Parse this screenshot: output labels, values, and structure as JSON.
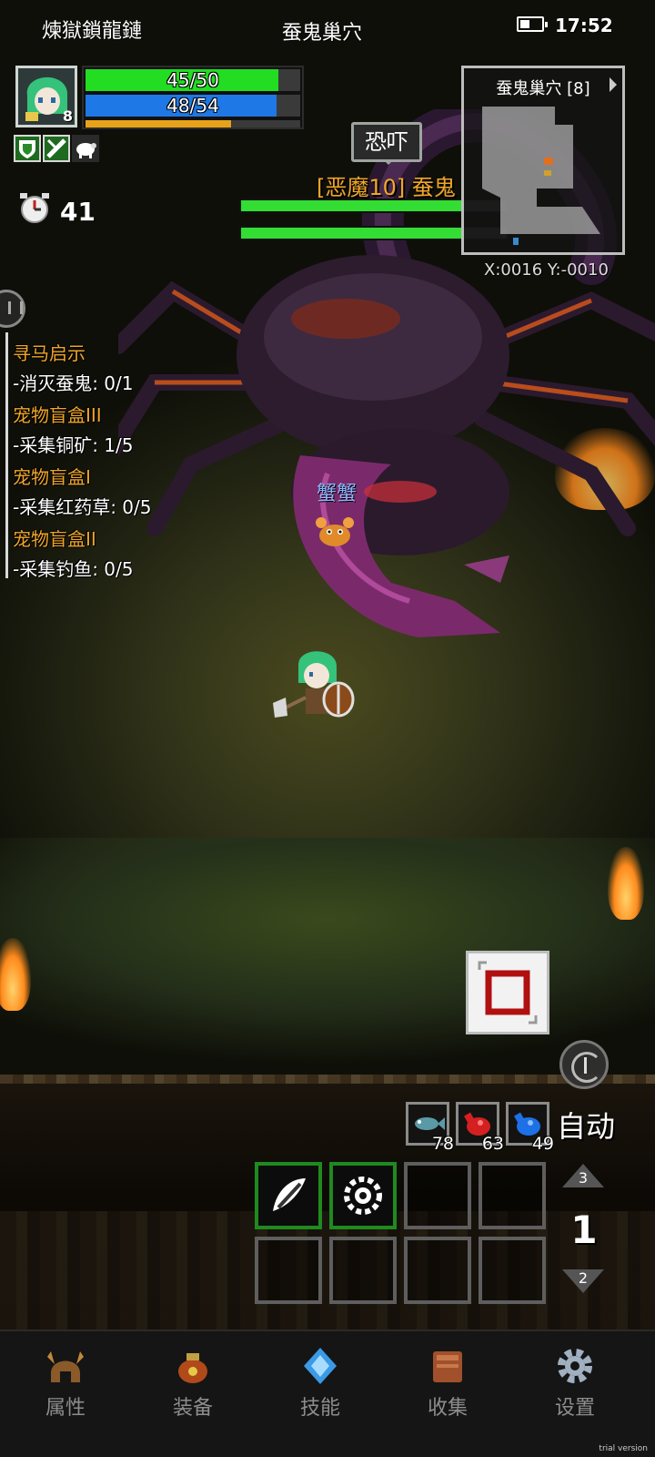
{
  "status_bar": {
    "app_title": "煉獄鎖龍鏈",
    "location": "蚕鬼巢穴",
    "time": "17:52"
  },
  "player": {
    "level": "8",
    "hp_text": "45/50",
    "hp_fraction": 0.9,
    "mp_text": "48/54",
    "mp_fraction": 0.889,
    "xp_fraction": 0.68,
    "timer_value": "41",
    "colors": {
      "hp": "#22dd22",
      "mp": "#1e78e6",
      "xp": "#e8a21a"
    }
  },
  "enemy": {
    "skill_popup": "恐吓",
    "name": "[恶魔10] 蚕鬼",
    "hp_fraction": 0.84,
    "shield_fraction": 0.84
  },
  "pet": {
    "name": "蟹蟹"
  },
  "minimap": {
    "title": "蚕鬼巢穴 [8]",
    "coords": "X:0016  Y:-0010"
  },
  "quests": [
    {
      "title": "寻马启示",
      "objective": "-消灭蚕鬼: 0/1"
    },
    {
      "title": "宠物盲盒III",
      "objective": "-采集铜矿: 1/5"
    },
    {
      "title": "宠物盲盒I",
      "objective": "-采集红药草: 0/5"
    },
    {
      "title": "宠物盲盒II",
      "objective": "-采集钓鱼: 0/5"
    }
  ],
  "consumables": [
    {
      "icon": "fish-icon",
      "count": "78"
    },
    {
      "icon": "red-potion-icon",
      "count": "63"
    },
    {
      "icon": "blue-potion-icon",
      "count": "49"
    }
  ],
  "controls": {
    "auto_label": "自动",
    "page_up": "3",
    "page_current": "1",
    "page_down": "2"
  },
  "skill_slots": [
    {
      "icon": "slash-skill-icon",
      "filled": true
    },
    {
      "icon": "gear-skill-icon",
      "filled": true
    },
    {
      "icon": "",
      "filled": false
    },
    {
      "icon": "",
      "filled": false
    },
    {
      "icon": "",
      "filled": false
    },
    {
      "icon": "",
      "filled": false
    },
    {
      "icon": "",
      "filled": false
    },
    {
      "icon": "",
      "filled": false
    }
  ],
  "bottom_nav": [
    {
      "label": "属性",
      "icon": "helmet-icon"
    },
    {
      "label": "装备",
      "icon": "bag-icon"
    },
    {
      "label": "技能",
      "icon": "crystal-icon"
    },
    {
      "label": "收集",
      "icon": "book-icon"
    },
    {
      "label": "设置",
      "icon": "gear-icon"
    }
  ],
  "watermark": "trial version"
}
